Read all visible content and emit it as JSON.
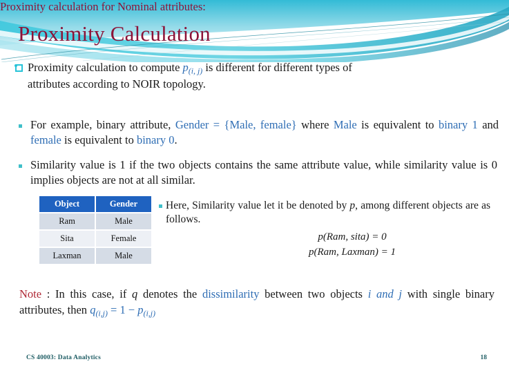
{
  "slide": {
    "title": "Proximity Calculation",
    "title_color": "#8C1338",
    "accent_color": "#27C3D8",
    "blue_color": "#2E6DB4",
    "table_header_color": "#1F62C0"
  },
  "intro": {
    "bullet": "square-bullet",
    "text_before": "Proximity calculation to compute ",
    "formula": "p",
    "formula_sub": "(i, j)",
    "text_after": " is different for different types of",
    "line2": "attributes according to NOIR topology."
  },
  "heading_nominal": "Proximity calculation for Nominal attributes:",
  "example": {
    "bullet": "dot-bullet",
    "seg1": "For example, binary attribute, ",
    "seg2_blue": "Gender = {Male, female}",
    "seg3": " where ",
    "seg4_blue": "Male",
    "seg5": " is",
    "line2_seg1": "equivalent to ",
    "line2_seg2_blue": "binary 1",
    "line2_seg3": " and ",
    "line2_seg4_blue": "female",
    "line2_seg5": " is equivalent to ",
    "line2_seg6_blue": "binary 0",
    "line2_seg7": "."
  },
  "similarity": {
    "bullet": "dot-bullet",
    "line1": "Similarity value is 1 if the two objects contains the same attribute value, while",
    "line2": "similarity value is 0 implies objects are not at all similar."
  },
  "table": {
    "columns": [
      "Object",
      "Gender"
    ],
    "rows": [
      [
        "Ram",
        "Male"
      ],
      [
        "Sita",
        "Female"
      ],
      [
        "Laxman",
        "Male"
      ]
    ]
  },
  "here": {
    "bullet": "dot-bullet",
    "seg1": "Here, Similarity value let it be denoted by ",
    "seg2_italic": "p",
    "seg3": ", among",
    "line2": "different objects are as follows."
  },
  "equations": [
    "p(Ram, sita) = 0",
    "p(Ram, Laxman) = 1"
  ],
  "note": {
    "label": "Note",
    "seg1": " : In this case, if ",
    "seg2_italic": "q",
    "seg3": " denotes the ",
    "seg4_blue": "dissimilarity",
    "seg5": " between two objects ",
    "seg6_blue_italic": "i and j",
    "seg7": " with",
    "line2_seg1": "single binary attributes, then ",
    "line2_formula_q": "q",
    "line2_formula_q_sub": "(i,j)",
    "line2_formula_mid": " = 1 − ",
    "line2_formula_p": "p",
    "line2_formula_p_sub": "(i,j)"
  },
  "footer": {
    "course": "CS 40003: Data Analytics",
    "page": "18",
    "color": "#1D5C63"
  }
}
